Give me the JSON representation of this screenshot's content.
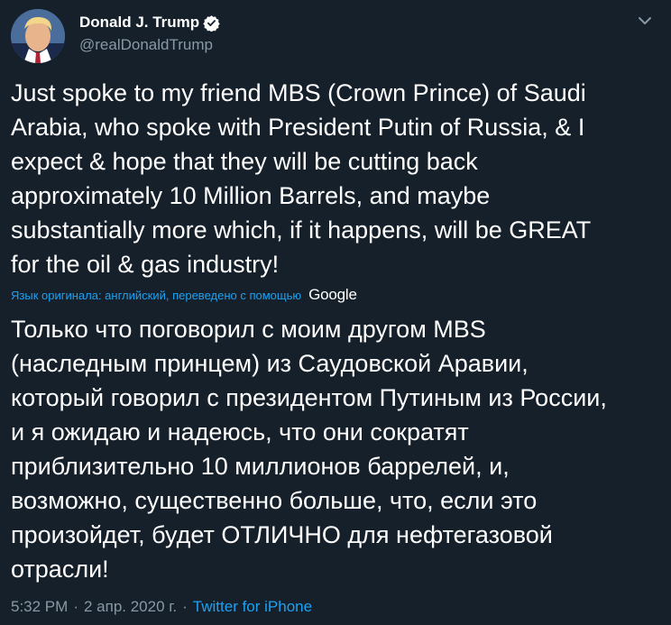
{
  "author": {
    "display_name": "Donald J. Trump",
    "handle": "@realDonaldTrump",
    "verified": true
  },
  "tweet": {
    "text": "Just spoke to my friend MBS (Crown Prince) of Saudi\nArabia, who spoke with President Putin of Russia, & I\nexpect & hope that they will be cutting back\napproximately 10 Million Barrels, and maybe\nsubstantially more which, if it happens, will be GREAT\nfor the oil & gas industry!",
    "translation_label": "Язык оригинала: английский, переведено с помощью",
    "translation_provider": "Google",
    "translated_text": "Только что поговорил с моим другом MBS\n(наследным принцем) из Саудовской Аравии,\nкоторый говорил с президентом Путиным из России,\nи я ожидаю и надеюсь, что они сократят\nприблизительно 10 миллионов баррелей, и,\nвозможно, существенно больше, что, если это\nпроизойдет, будет ОТЛИЧНО для нефтегазовой\nотрасли!"
  },
  "meta": {
    "time": "5:32 PM",
    "separator": "·",
    "date": "2 апр. 2020 г.",
    "source": "Twitter for iPhone"
  },
  "colors": {
    "background": "#15202b",
    "text": "#ffffff",
    "secondary": "#8899a6",
    "accent": "#1da1f2"
  },
  "icons": {
    "verified": "verified-badge-icon",
    "menu": "chevron-down-icon"
  }
}
